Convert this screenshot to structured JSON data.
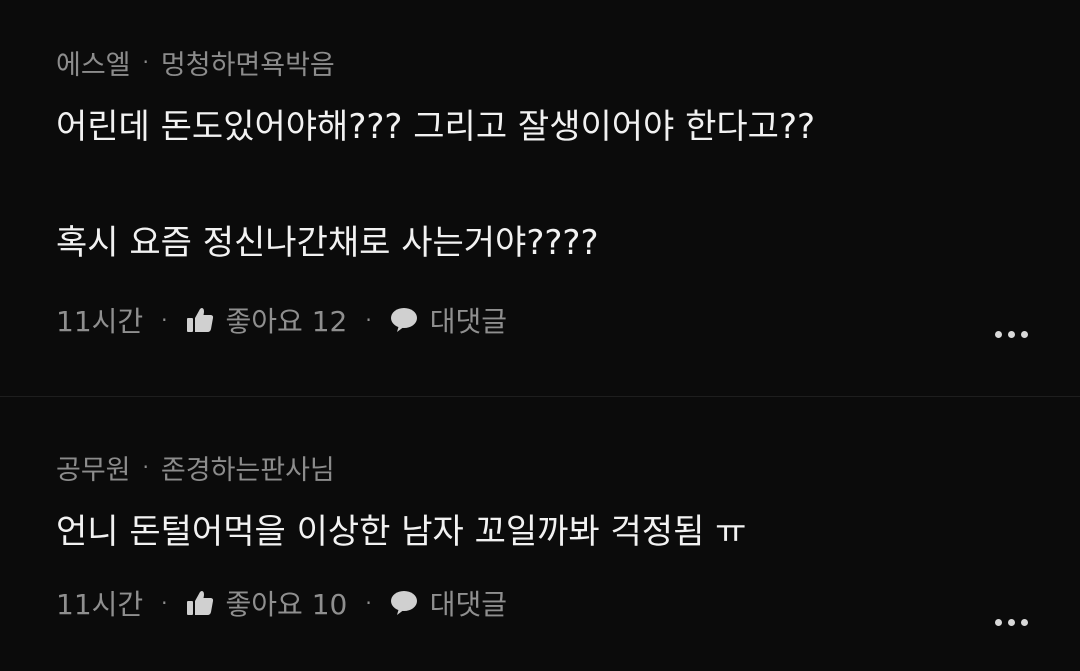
{
  "comments": [
    {
      "author": "에스엘",
      "title": "멍청하면욕박음",
      "text": "어린데 돈도있어야해??? 그리고 잘생이어야 한다고??\n\n혹시 요즘 정신나간채로 사는거야????",
      "time": "11시간",
      "like_label": "좋아요 12",
      "reply_label": "대댓글"
    },
    {
      "author": "공무원",
      "title": "존경하는판사님",
      "text": "언니 돈털어먹을 이상한 남자 꼬일까봐 걱정됨 ㅠ",
      "time": "11시간",
      "like_label": "좋아요 10",
      "reply_label": "대댓글"
    }
  ],
  "icons": {
    "like": "thumbs-up-icon",
    "reply": "speech-bubble-icon",
    "more": "more-horizontal-icon"
  },
  "colors": {
    "background": "#0b0b0b",
    "text": "#f2f2f2",
    "muted": "#8c8c8c"
  }
}
